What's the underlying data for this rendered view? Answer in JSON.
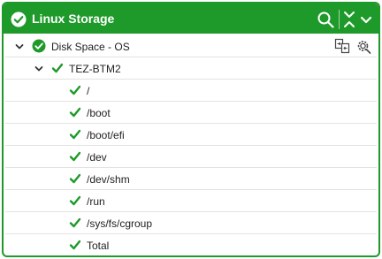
{
  "widget": {
    "title": "Linux Storage",
    "accent_color": "#1e9a2a",
    "status": "ok"
  },
  "header_icons": [
    "check-circle-icon",
    "search-icon",
    "collapse-all-icon",
    "chevron-down-icon"
  ],
  "tree": {
    "group": {
      "label": "Disk Space - OS",
      "status": "ok",
      "expanded": true
    },
    "host": {
      "label": "TEZ-BTM2",
      "status": "ok",
      "expanded": true
    },
    "items": [
      {
        "label": "/",
        "status": "ok"
      },
      {
        "label": "/boot",
        "status": "ok"
      },
      {
        "label": "/boot/efi",
        "status": "ok"
      },
      {
        "label": "/dev",
        "status": "ok"
      },
      {
        "label": "/dev/shm",
        "status": "ok"
      },
      {
        "label": "/run",
        "status": "ok"
      },
      {
        "label": "/sys/fs/cgroup",
        "status": "ok"
      },
      {
        "label": "Total",
        "status": "ok"
      }
    ]
  },
  "row_tools": [
    "swap-view-icon",
    "settings-gear-icon"
  ]
}
